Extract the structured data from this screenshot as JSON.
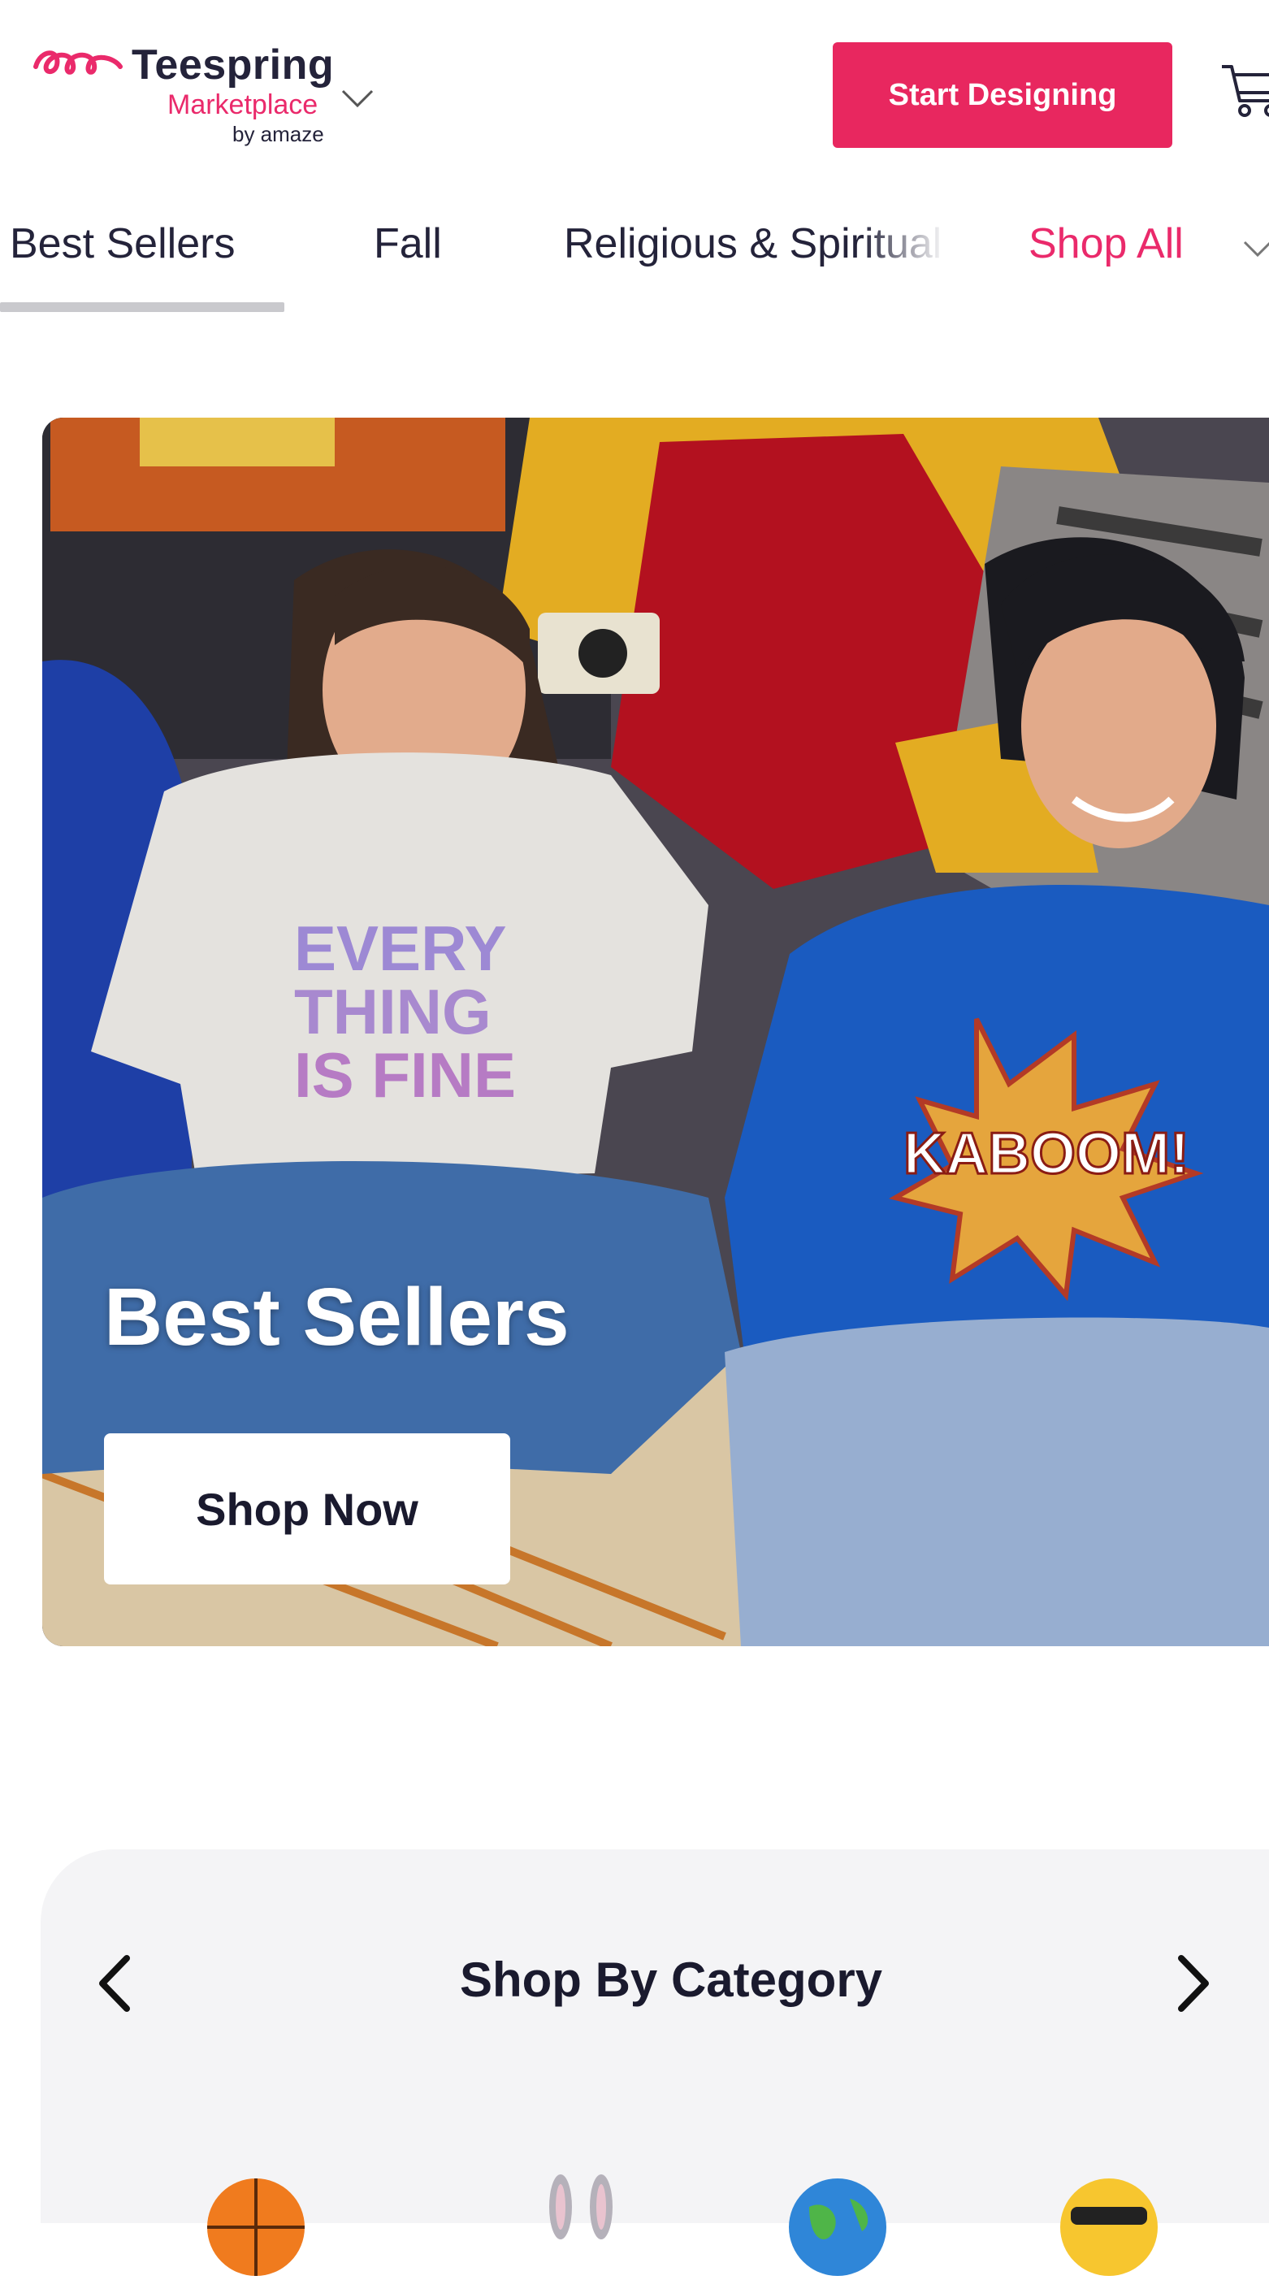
{
  "header": {
    "logo_brand": "Teespring",
    "logo_sub": "Marketplace",
    "logo_by": "by amaze",
    "cta_label": "Start Designing",
    "accent_color": "#e8275f",
    "cart_icon": "cart-icon"
  },
  "nav": {
    "tabs": [
      {
        "label": "Best Sellers",
        "active": true
      },
      {
        "label": "Fall"
      },
      {
        "label": "Religious & Spiritual"
      },
      {
        "label": "Shop All",
        "highlight_color": "#ea2a6b"
      }
    ]
  },
  "hero": {
    "title": "Best Sellers",
    "button_label": "Shop Now",
    "shirt_left_text": [
      "EVERY",
      "THING",
      "IS FINE"
    ],
    "shirt_right_text": "KABOOM!"
  },
  "category": {
    "title": "Shop By Category",
    "prev_icon": "chevron-left-icon",
    "next_icon": "chevron-right-icon",
    "icons": [
      "basketball-icon",
      "bunny-icon",
      "globe-icon",
      "sunglasses-emoji-icon"
    ]
  }
}
